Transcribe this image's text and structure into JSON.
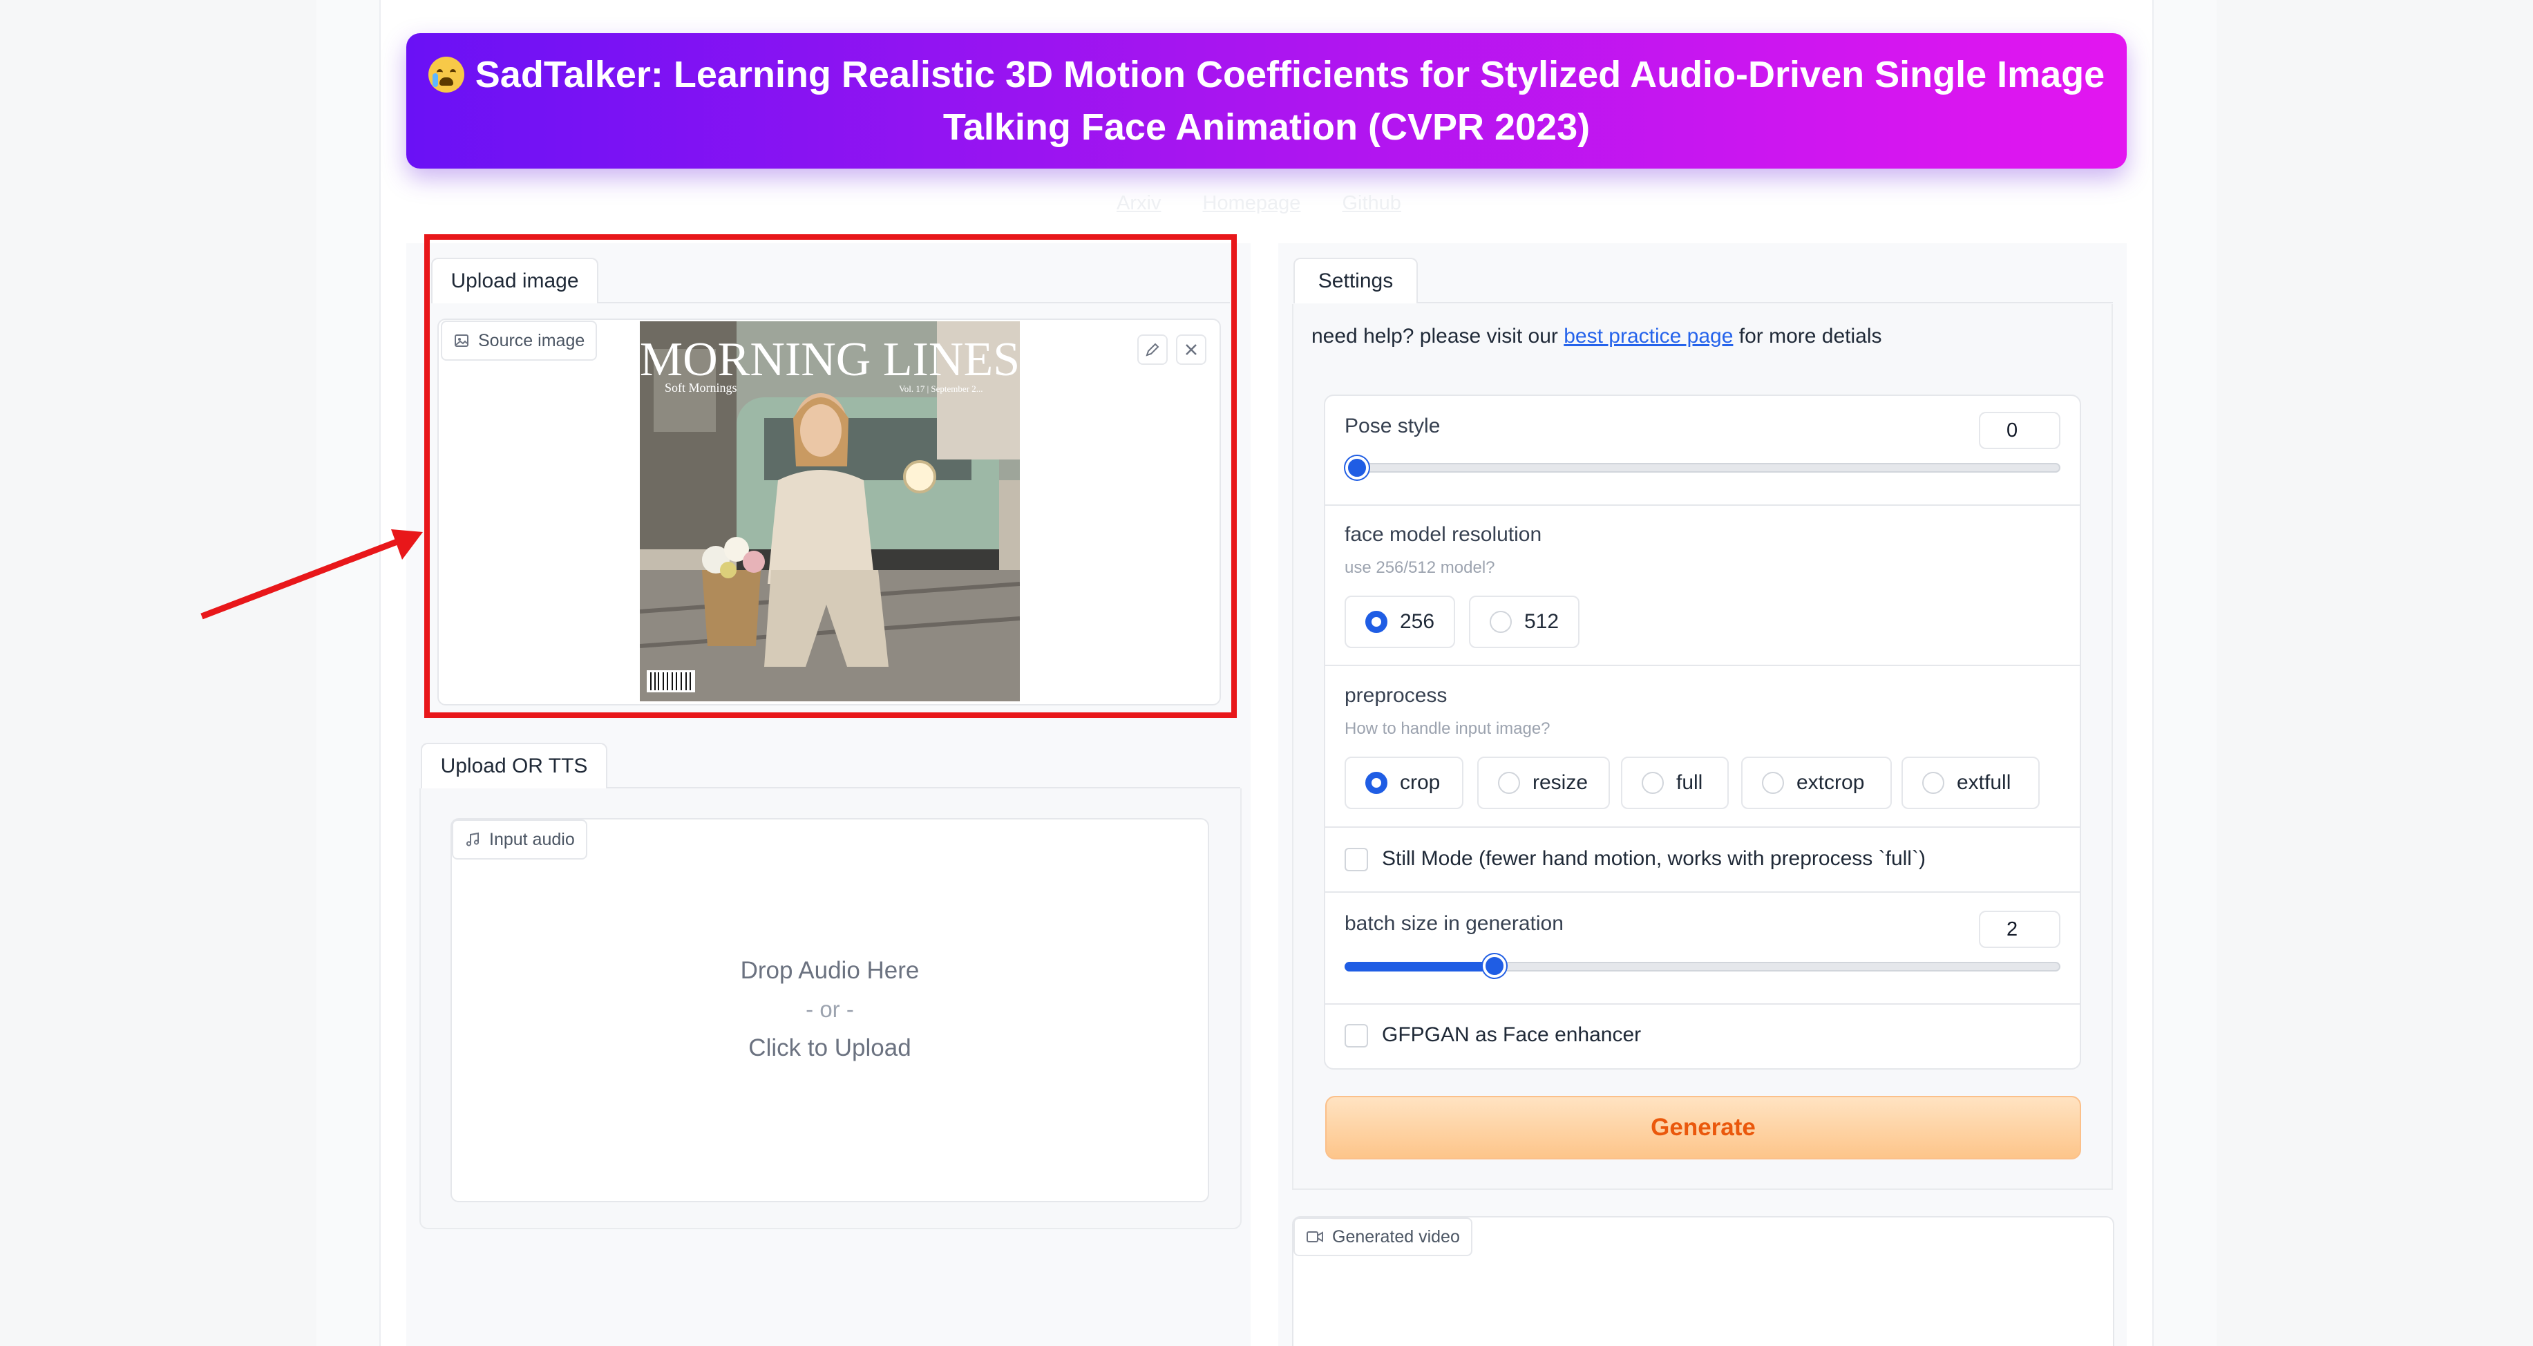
{
  "header": {
    "title_line1": "SadTalker: Learning Realistic 3D Motion Coefficients for Stylized Audio-Driven Single Image",
    "title_line2": "Talking Face Animation (CVPR 2023)",
    "emoji_icon": "crying-face-icon",
    "links": [
      "Arxiv",
      "Homepage",
      "Github"
    ]
  },
  "upload_image": {
    "tab_label": "Upload image",
    "source_label": "Source image",
    "magazine_title": "MORNING LINES",
    "magazine_subtitle": "Soft Mornings",
    "magazine_issue": "Vol. 17 | September 2..."
  },
  "audio": {
    "tab_label": "Upload OR TTS",
    "input_label": "Input audio",
    "drop_text": "Drop Audio Here",
    "or_text": "- or -",
    "click_text": "Click to Upload"
  },
  "settings": {
    "tab_label": "Settings",
    "help_prefix": "need help? please visit our ",
    "help_link": "best practice page",
    "help_suffix": " for more detials",
    "pose_style": {
      "label": "Pose style",
      "value": "0",
      "fraction": 0.0
    },
    "face_model": {
      "label": "face model resolution",
      "sublabel": "use 256/512 model?",
      "options": [
        "256",
        "512"
      ],
      "selected": "256"
    },
    "preprocess": {
      "label": "preprocess",
      "sublabel": "How to handle input image?",
      "options": [
        "crop",
        "resize",
        "full",
        "extcrop",
        "extfull"
      ],
      "selected": "crop"
    },
    "still_mode": {
      "label": "Still Mode (fewer hand motion, works with preprocess `full`)",
      "checked": false
    },
    "batch_size": {
      "label": "batch size in generation",
      "value": "2",
      "fraction": 0.2
    },
    "gfpgan": {
      "label": "GFPGAN as Face enhancer",
      "checked": false
    },
    "generate_label": "Generate"
  },
  "output": {
    "video_label": "Generated video"
  },
  "colors": {
    "accent": "#1f5de4",
    "highlight_box": "#e8171a",
    "generate_text": "#ea580c"
  }
}
